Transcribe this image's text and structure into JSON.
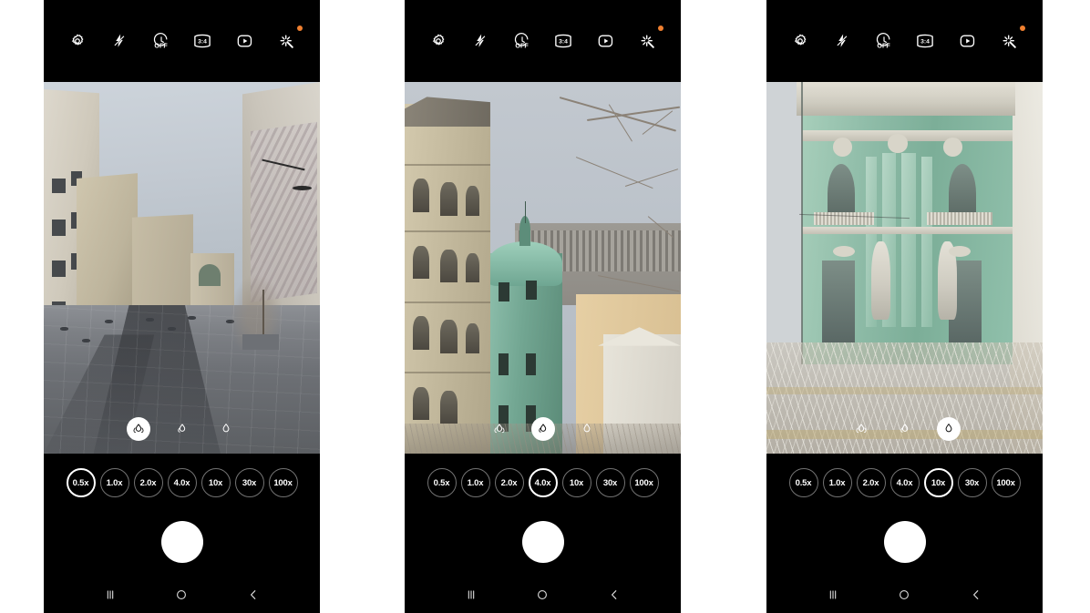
{
  "app": {
    "name": "Camera",
    "platform": "Android (One UI)"
  },
  "toolbar": {
    "items": [
      {
        "icon": "settings-gear-icon",
        "label": "Settings",
        "state": ""
      },
      {
        "icon": "flash-off-icon",
        "label": "Flash",
        "state": "off"
      },
      {
        "icon": "timer-icon",
        "label": "Timer",
        "state": "OFF"
      },
      {
        "icon": "aspect-ratio-icon",
        "label": "Aspect ratio",
        "state": "3:4"
      },
      {
        "icon": "motion-photo-icon",
        "label": "Motion photo",
        "state": ""
      },
      {
        "icon": "filters-effects-icon",
        "label": "Filters and effects",
        "state": "",
        "badge": true
      }
    ],
    "badge_color": "#f08030"
  },
  "lens_selector": {
    "options": [
      {
        "icon": "ultrawide-lens-icon",
        "label": "Ultra wide"
      },
      {
        "icon": "wide-lens-icon",
        "label": "Wide"
      },
      {
        "icon": "tele-lens-icon",
        "label": "Telephoto"
      }
    ]
  },
  "zoom_chips": {
    "labels": [
      "0.5x",
      "1.0x",
      "2.0x",
      "4.0x",
      "10x",
      "30x",
      "100x"
    ]
  },
  "navbar": {
    "items": [
      {
        "icon": "recents-icon",
        "label": "Recents"
      },
      {
        "icon": "home-icon",
        "label": "Home"
      },
      {
        "icon": "back-icon",
        "label": "Back"
      }
    ]
  },
  "shutter": {
    "label": "Take picture"
  },
  "panels": [
    {
      "id": "panel-0.5x",
      "selected_zoom": "0.5x",
      "selected_zoom_index": 0,
      "selected_lens_index": 0,
      "scene": "ultra-wide view of a wet granite city square with beige apartment buildings on the left, a mural-covered building on the right, bare trees and a grey overcast sky"
    },
    {
      "id": "panel-4.0x",
      "selected_zoom": "4.0x",
      "selected_zoom_index": 3,
      "selected_lens_index": 1,
      "scene": "4x zoom on an art nouveau corner building with a green oxidised copper dome, a cream ornate facade on the left, a concrete colonnade behind and bare branches across the sky"
    },
    {
      "id": "panel-10x",
      "selected_zoom": "10x",
      "selected_zoom_index": 4,
      "selected_lens_index": 2,
      "scene": "10x zoom detail of the same green building showing two stone caryatid figures, arched windows, stucco balconies and frosted bare branches below"
    }
  ],
  "colors": {
    "chassis": "#000000",
    "page_background": "#ffffff",
    "accent_badge": "#f08030",
    "ui_white": "#ffffff"
  }
}
